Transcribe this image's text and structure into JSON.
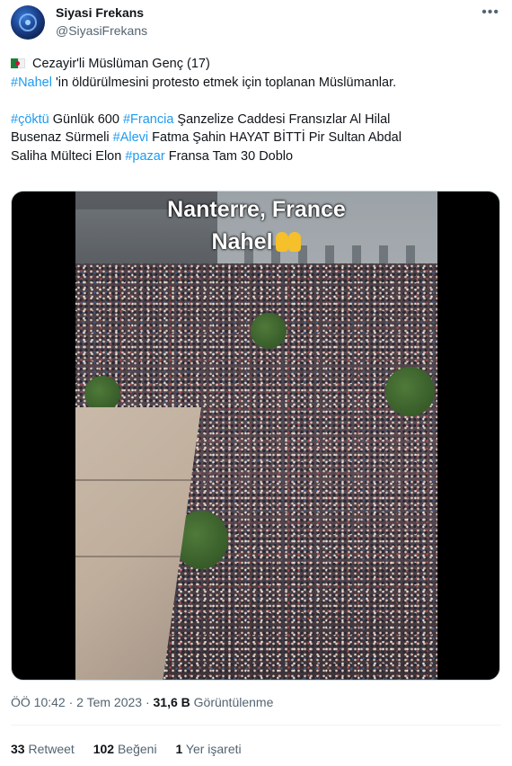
{
  "author": {
    "name": "Siyasi Frekans",
    "handle": "@SiyasiFrekans"
  },
  "more_icon": "more-horizontal-icon",
  "tweet": {
    "flag": "algeria-flag-emoji",
    "line1": "Cezayir'li Müslüman Genç (17)",
    "line2_tag": "#Nahel",
    "line2_rest": " 'in öldürülmesini protesto etmek için toplanan Müslümanlar.",
    "line3_tag1": "#çöktü",
    "line3_text1": " Günlük 600 ",
    "line3_tag2": "#Francia",
    "line3_text2": " Şanzelize Caddesi Fransızlar Al Hilal",
    "line4_text1": "Busenaz Sürmeli ",
    "line4_tag": "#Alevi",
    "line4_text2": " Fatma Şahin HAYAT BİTTİ Pir Sultan Abdal",
    "line5_text1": "Saliha Mülteci Elon ",
    "line5_tag": "#pazar",
    "line5_text2": " Fransa Tam 30 Doblo",
    "hashtag_color": "#1d9bf0"
  },
  "media": {
    "caption_line1": "Nanterre, France",
    "caption_line2": "Nahel",
    "caption_emoji": "raising-hands-icon"
  },
  "meta": {
    "time": "ÖÖ 10:42 · 2 Tem 2023 · ",
    "views_count": "31,6 B",
    "views_label": " Görüntülenme"
  },
  "stats": {
    "retweets_count": "33",
    "retweets_label": " Retweet",
    "likes_count": "102",
    "likes_label": " Beğeni",
    "bookmarks_count": "1",
    "bookmarks_label": " Yer işareti"
  }
}
